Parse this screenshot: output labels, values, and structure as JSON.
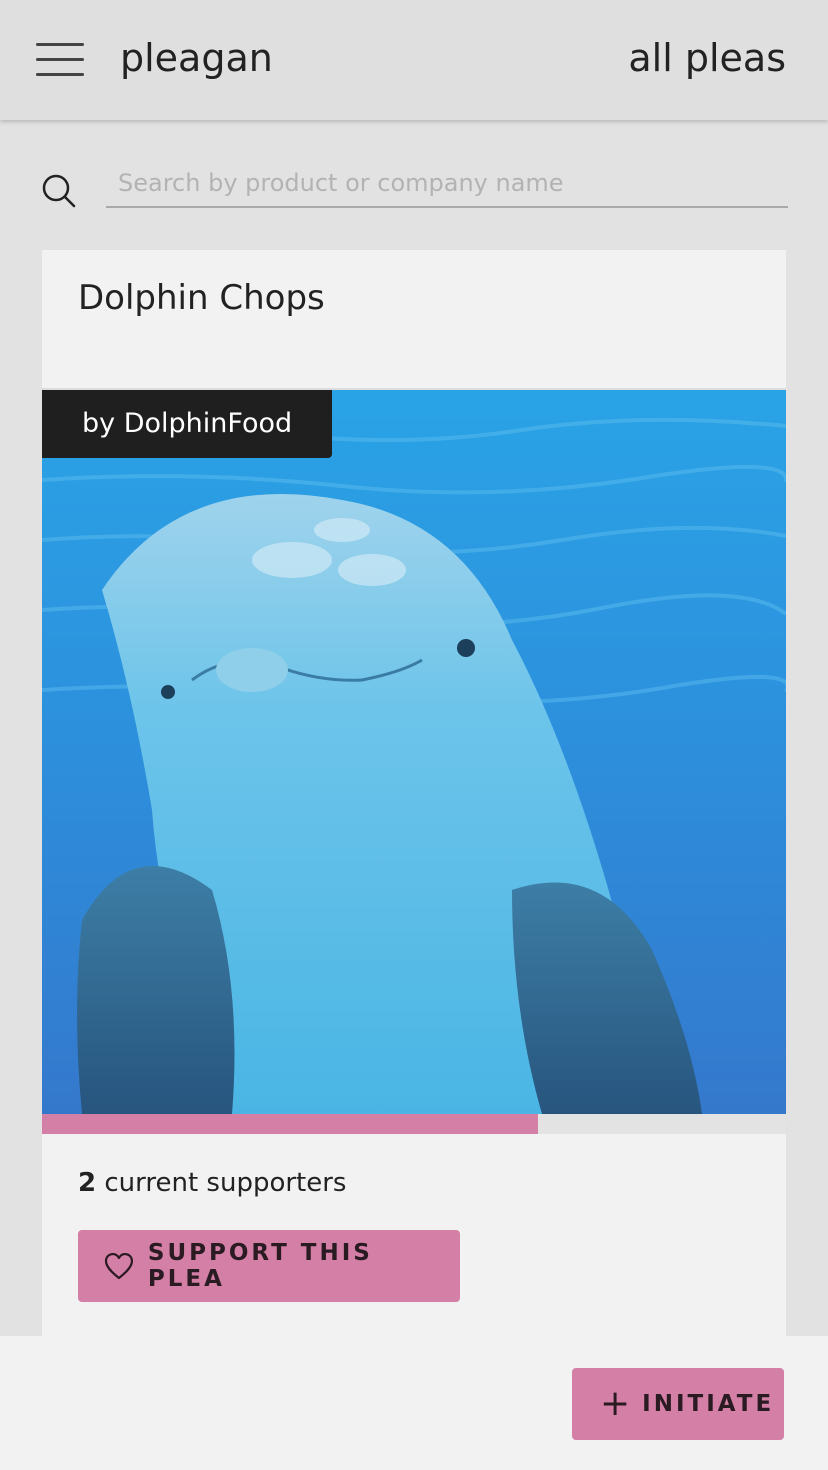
{
  "header": {
    "brand": "pleagan",
    "nav_link": "all pleas",
    "menu_icon": "hamburger-menu-icon"
  },
  "search": {
    "placeholder": "Search by product or company name",
    "value": "",
    "icon": "search-icon"
  },
  "plea": {
    "title": "Dolphin Chops",
    "company_label": "by DolphinFood",
    "progress_fraction": 0.667,
    "supporter_count": "2",
    "supporters_suffix": " current supporters",
    "support_button": "SUPPORT THIS PLEA",
    "support_icon": "heart-icon"
  },
  "footer": {
    "initiate_button": "INITIATE",
    "initiate_icon": "plus-icon"
  },
  "colors": {
    "accent": "#d47fa6",
    "badge_bg": "#1f1f1f",
    "background": "#e2e2e2",
    "card": "#f2f2f2"
  }
}
